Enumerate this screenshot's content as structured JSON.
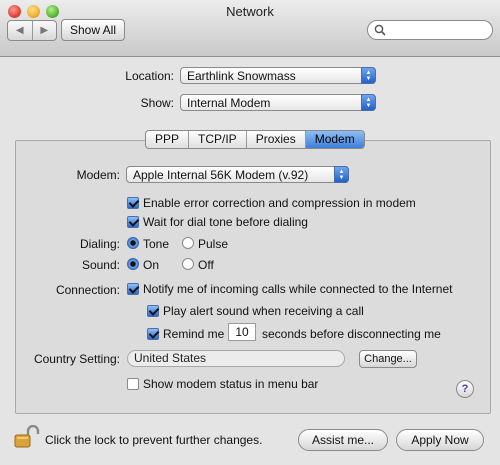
{
  "window": {
    "title": "Network"
  },
  "toolbar": {
    "show_all_label": "Show All",
    "back_glyph": "◀",
    "forward_glyph": "▶",
    "search_placeholder": ""
  },
  "top": {
    "location_label": "Location:",
    "location_value": "Earthlink Snowmass",
    "show_label": "Show:",
    "show_value": "Internal Modem"
  },
  "tabs": [
    {
      "label": "PPP"
    },
    {
      "label": "TCP/IP"
    },
    {
      "label": "Proxies"
    },
    {
      "label": "Modem",
      "active": true
    }
  ],
  "modem": {
    "modem_label": "Modem:",
    "modem_value": "Apple Internal 56K Modem (v.92)",
    "error_correction": {
      "label": "Enable error correction and compression in modem",
      "checked": true
    },
    "wait_dial_tone": {
      "label": "Wait for dial tone before dialing",
      "checked": true
    },
    "dialing": {
      "label": "Dialing:",
      "options": [
        "Tone",
        "Pulse"
      ],
      "selected": "Tone"
    },
    "sound": {
      "label": "Sound:",
      "options": [
        "On",
        "Off"
      ],
      "selected": "On"
    },
    "connection": {
      "label": "Connection:",
      "notify": {
        "label": "Notify me of incoming calls while connected to the Internet",
        "checked": true
      },
      "play_alert": {
        "label": "Play alert sound when receiving a call",
        "checked": true
      },
      "remind_prefix": "Remind me",
      "remind_value": "10",
      "remind_suffix": "seconds before disconnecting me",
      "remind_checked": true
    },
    "country_label": "Country Setting:",
    "country_value": "United States",
    "change_label": "Change...",
    "status_menu": {
      "label": "Show modem status in menu bar",
      "checked": false
    },
    "help_glyph": "?"
  },
  "footer": {
    "lock_text": "Click the lock to prevent further changes.",
    "assist_label": "Assist me...",
    "apply_label": "Apply Now"
  },
  "colors": {
    "accent": "#3f7fd9",
    "window_bg": "#e4e4e4"
  }
}
